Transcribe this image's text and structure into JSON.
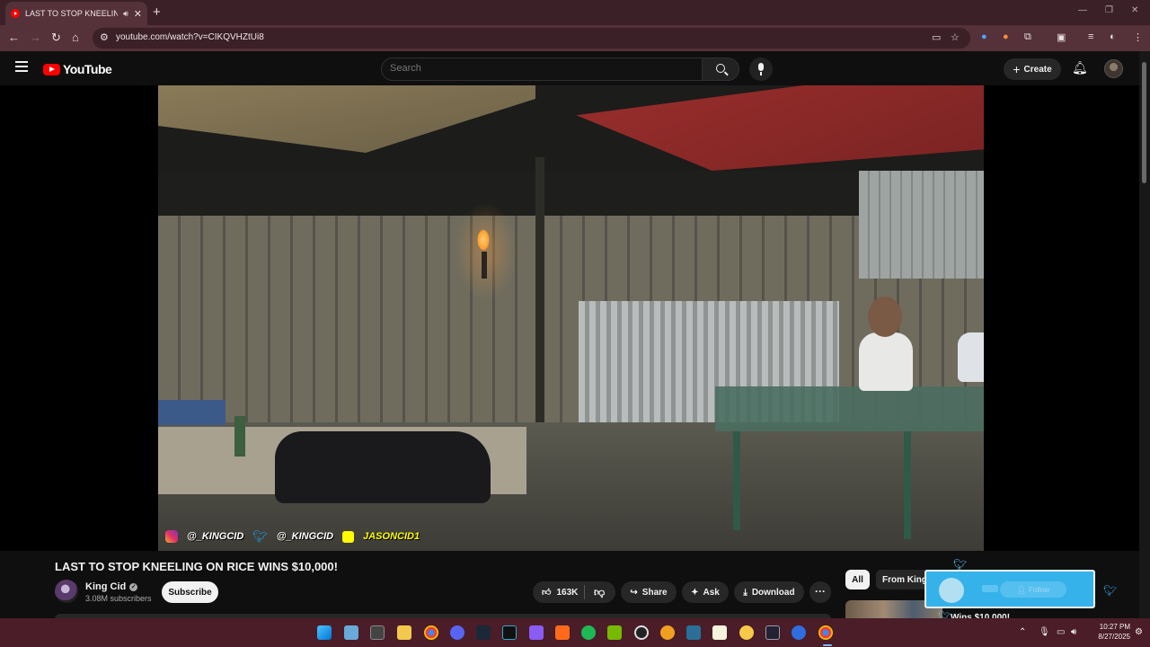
{
  "browser": {
    "tab_title": "LAST TO STOP KNEELING O",
    "new_tab_symbol": "+",
    "url": "youtube.com/watch?v=CIKQVHZtUi8"
  },
  "youtube": {
    "logo_text": "YouTube",
    "search_placeholder": "Search",
    "create_label": "Create"
  },
  "video": {
    "title": "LAST TO STOP KNEELING ON RICE WINS $10,000!",
    "overlay_handles": [
      "@_KINGCID",
      "@_KINGCID",
      "JASONCID1"
    ]
  },
  "channel": {
    "name": "King Cid",
    "subscribers": "3.08M subscribers",
    "subscribe_label": "Subscribe"
  },
  "actions": {
    "likes": "163K",
    "share": "Share",
    "ask": "Ask",
    "download": "Download",
    "more": "···"
  },
  "sidebar": {
    "chips": [
      "All",
      "From King C"
    ],
    "rec_title": "Wins $10,000!"
  },
  "popup": {
    "follow_label": "Follow"
  },
  "taskbar": {
    "time": "10:27 PM",
    "date": "8/27/2025"
  }
}
